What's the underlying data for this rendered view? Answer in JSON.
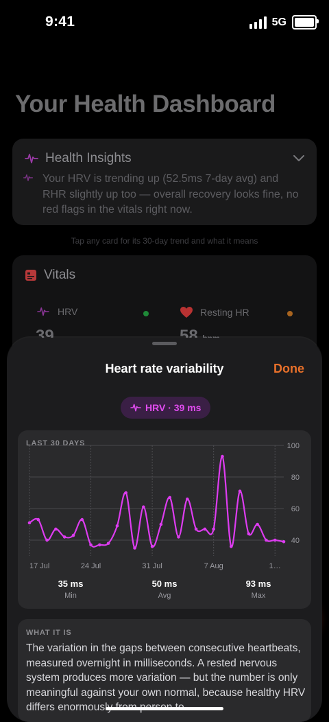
{
  "status_bar": {
    "time": "9:41",
    "network": "5G",
    "battery_icon": "battery-full-icon",
    "signal_icon": "signal-bars-icon"
  },
  "page": {
    "title": "Your Health Dashboard"
  },
  "insights": {
    "title": "Health Insights",
    "icon": "heartbeat-icon",
    "body": "Your HRV is trending up (52.5ms 7-day avg) and RHR slightly up too — overall recovery looks fine, no red flags in the vitals right now.",
    "chevron": "chevron-down-icon"
  },
  "hint": "Tap any card for its 30-day trend and what it means",
  "vitals": {
    "title": "Vitals",
    "items": [
      {
        "label": "HRV",
        "value": "39",
        "icon": "heartbeat-icon",
        "status_color": "#2db84b"
      },
      {
        "label": "Resting HR",
        "value": "58",
        "unit": "bpm",
        "icon": "heart-icon",
        "status_color": "#e58a2a"
      }
    ]
  },
  "sheet": {
    "title": "Heart rate variability",
    "done_label": "Done",
    "pill_label": "HRV · 39 ms",
    "chart_card_label": "LAST 30 DAYS",
    "stats": [
      {
        "value": "35 ms",
        "label": "Min"
      },
      {
        "value": "50 ms",
        "label": "Avg"
      },
      {
        "value": "93 ms",
        "label": "Max"
      }
    ],
    "what_label": "WHAT IT IS",
    "what_body": "The variation in the gaps between consecutive heartbeats, measured overnight in milliseconds. A rested nervous system produces more variation — but the number is only meaningful against your own normal, because healthy HRV differs enormously from person to"
  },
  "colors": {
    "accent": "#e8702a",
    "hrv": "#dd3cf0"
  },
  "chart_data": {
    "type": "line",
    "title": "",
    "xlabel": "",
    "ylabel": "",
    "x_tick_labels": [
      "17 Jul",
      "24 Jul",
      "31 Jul",
      "7 Aug",
      "1…"
    ],
    "y_ticks": [
      40,
      60,
      80,
      100
    ],
    "ylim": [
      30,
      100
    ],
    "grid": true,
    "series": [
      {
        "name": "",
        "values": [
          51,
          53,
          40,
          47,
          42,
          43,
          53,
          37,
          37,
          38,
          49,
          70,
          35,
          61,
          36,
          50,
          67,
          42,
          66,
          47,
          47,
          47,
          93,
          36,
          71,
          44,
          50,
          40,
          40,
          39
        ]
      }
    ]
  }
}
